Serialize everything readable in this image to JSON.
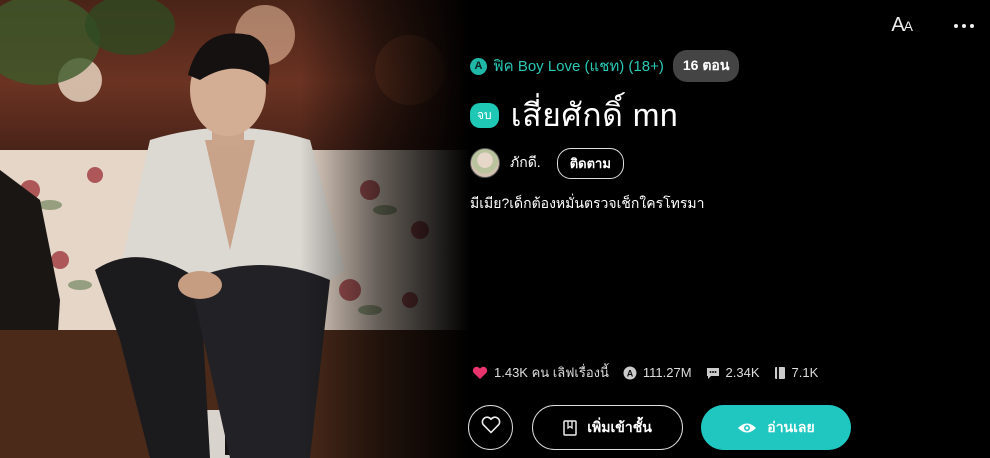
{
  "header": {
    "font_size_icon": "Aa-icon",
    "more_icon": "more-vertical-icon"
  },
  "story": {
    "category_icon": "A",
    "category": "ฟิค Boy Love (แชท) (18+)",
    "episodes": "16 ตอน",
    "status_badge": "จบ",
    "title": "เสี่ยศักดิ์ mn",
    "author": "ภักดี.",
    "follow_label": "ติดตาม",
    "synopsis": "มีเมีย?เด็กต้องหมั่นตรวจเช็กใครโทรมา"
  },
  "stats": {
    "likes": "1.43K คน เลิฟเรื่องนี้",
    "views": "111.27M",
    "comments": "2.34K",
    "bookmarks": "7.1K"
  },
  "actions": {
    "add_label": "เพิ่มเข้าชั้น",
    "read_label": "อ่านเลย"
  },
  "colors": {
    "accent": "#1fc7c0",
    "category_text": "#29c9b5",
    "heart": "#e8336d",
    "pill_bg": "#444444"
  }
}
